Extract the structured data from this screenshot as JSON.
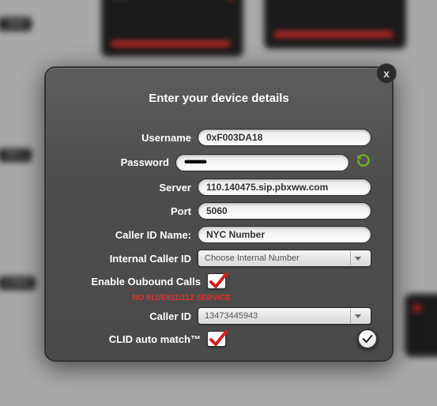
{
  "modal": {
    "title": "Enter your device details",
    "close": "x",
    "labels": {
      "username": "Username",
      "password": "Password",
      "server": "Server",
      "port": "Port",
      "caller_id_name": "Caller ID Name:",
      "internal_caller_id": "Internal Caller ID",
      "enable_outbound": "Enable Oubound Calls",
      "caller_id": "Caller ID",
      "clid_auto": "CLID auto match™"
    },
    "values": {
      "username": "0xF003DA18",
      "password": "••••••••••",
      "server": "110.140475.sip.pbxww.com",
      "port": "5060",
      "caller_id_name": "NYC Number",
      "internal_caller_id": "Choose Internal Number",
      "caller_id": "13473445943"
    },
    "checks": {
      "enable_outbound": true,
      "clid_auto": true
    },
    "warning": "NO 911/E911/112 SERVICE"
  }
}
